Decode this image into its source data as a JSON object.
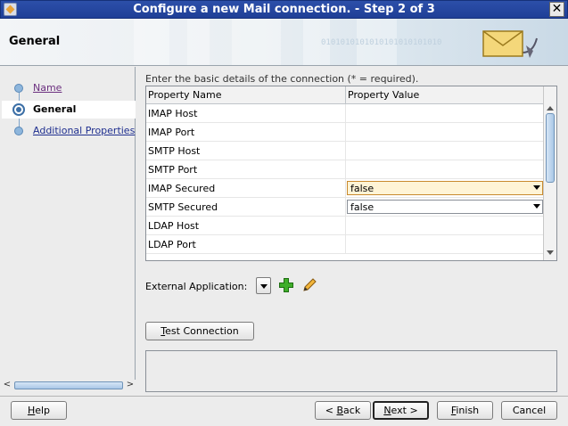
{
  "window": {
    "title": "Configure a new Mail connection. - Step 2 of 3",
    "close_glyph": "✕"
  },
  "header": {
    "title": "General",
    "binary_text": "0101010101010101010101010"
  },
  "nav": {
    "items": [
      {
        "label": "Name",
        "state": "visited"
      },
      {
        "label": "General",
        "state": "current"
      },
      {
        "label": "Additional Properties",
        "state": "link"
      }
    ],
    "scroll_left": "<",
    "scroll_right": ">"
  },
  "instruction": "Enter the basic details of the connection (* = required).",
  "table": {
    "headers": [
      "Property Name",
      "Property Value"
    ],
    "rows": [
      {
        "name": "IMAP Host",
        "value": ""
      },
      {
        "name": "IMAP Port",
        "value": ""
      },
      {
        "name": "SMTP Host",
        "value": ""
      },
      {
        "name": "SMTP Port",
        "value": ""
      },
      {
        "name": "IMAP Secured",
        "value": "false"
      },
      {
        "name": "SMTP Secured",
        "value": "false"
      },
      {
        "name": "LDAP Host",
        "value": ""
      },
      {
        "name": "LDAP Port",
        "value": ""
      }
    ]
  },
  "external_application": {
    "label": "External Application:"
  },
  "buttons": {
    "test_connection": {
      "mnemonic": "T",
      "rest": "est Connection"
    },
    "help": {
      "mnemonic": "H",
      "rest": "elp"
    },
    "back": {
      "prefix": "< ",
      "mnemonic": "B",
      "rest": "ack"
    },
    "next": {
      "mnemonic": "N",
      "rest": "ext >"
    },
    "finish": {
      "mnemonic": "F",
      "rest": "inish"
    },
    "cancel": {
      "label": "Cancel"
    }
  },
  "colors": {
    "title_bar": "#2c4fa9",
    "link": "#1f2f8f",
    "focused_select": "#fff4d6"
  }
}
